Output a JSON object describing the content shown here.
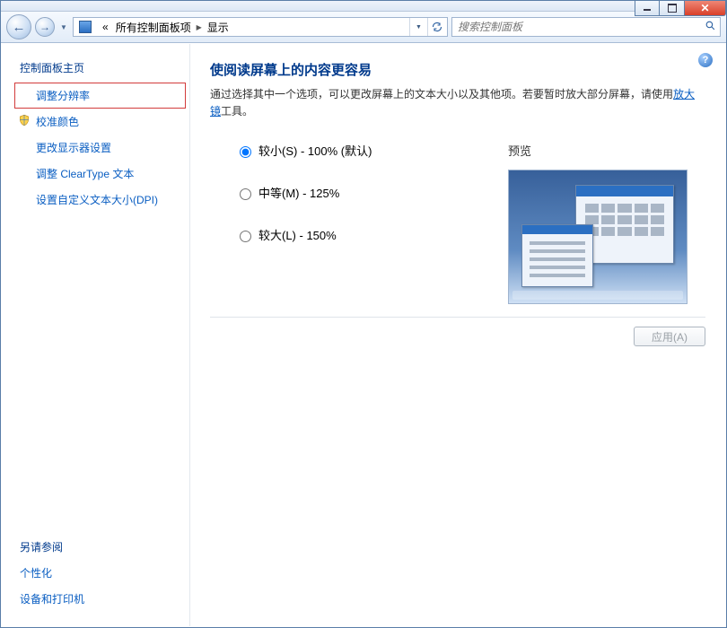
{
  "breadcrumb": {
    "root_glyph": "«",
    "level1": "所有控制面板项",
    "level2": "显示"
  },
  "search": {
    "placeholder": "搜索控制面板"
  },
  "sidebar": {
    "home": "控制面板主页",
    "items": [
      {
        "label": "调整分辨率",
        "highlighted": true,
        "shield": false
      },
      {
        "label": "校准颜色",
        "highlighted": false,
        "shield": true
      },
      {
        "label": "更改显示器设置",
        "highlighted": false,
        "shield": false
      },
      {
        "label": "调整 ClearType 文本",
        "highlighted": false,
        "shield": false
      },
      {
        "label": "设置自定义文本大小(DPI)",
        "highlighted": false,
        "shield": false
      }
    ],
    "see_also_header": "另请参阅",
    "see_also": [
      {
        "label": "个性化"
      },
      {
        "label": "设备和打印机"
      }
    ]
  },
  "main": {
    "title": "使阅读屏幕上的内容更容易",
    "desc_1": "通过选择其中一个选项，可以更改屏幕上的文本大小以及其他项。若要暂时放大部分屏幕，请使用",
    "desc_link": "放大镜",
    "desc_2": "工具。",
    "preview_label": "预览",
    "options": [
      {
        "label": "较小(S) - 100% (默认)",
        "checked": true
      },
      {
        "label": "中等(M) - 125%",
        "checked": false
      },
      {
        "label": "较大(L) - 150%",
        "checked": false
      }
    ],
    "apply_label": "应用(A)"
  }
}
